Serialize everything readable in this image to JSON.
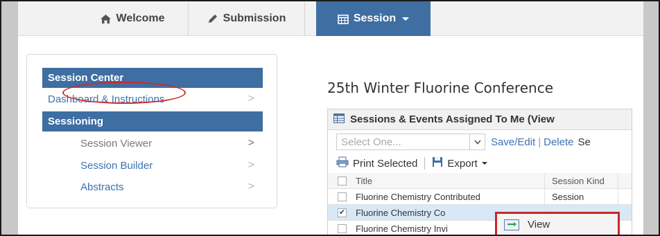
{
  "nav": {
    "tabs": [
      {
        "label": "Welcome",
        "icon": "home-icon"
      },
      {
        "label": "Submission",
        "icon": "pencil-icon"
      },
      {
        "label": "Session",
        "icon": "calendar-icon",
        "active": true
      }
    ]
  },
  "sidebar": {
    "section1": "Session Center",
    "dashboard": "Dashboard & Instructions",
    "section2": "Sessioning",
    "items": [
      {
        "label": "Session Viewer"
      },
      {
        "label": "Session Builder"
      },
      {
        "label": "Abstracts"
      }
    ],
    "arrow": ">"
  },
  "main": {
    "title": "25th Winter Fluorine Conference",
    "panel_title": "Sessions & Events Assigned To Me (View",
    "select_placeholder": "Select One...",
    "save_edit": "Save/Edit",
    "divider": "|",
    "delete": "Delete",
    "cut_text": "Se",
    "print_selected": "Print Selected",
    "export": "Export",
    "columns": [
      "Title",
      "Session Kind"
    ],
    "rows": [
      {
        "title": "Fluorine Chemistry Contributed",
        "kind": "Session",
        "checked": false
      },
      {
        "title": "Fluorine Chemistry Co",
        "kind": "",
        "checked": true
      },
      {
        "title": "Fluorine Chemistry Invi",
        "kind": "",
        "checked": false
      }
    ]
  },
  "context_menu": {
    "view": "View"
  },
  "colors": {
    "accent": "#3f6ea3",
    "link": "#3b73b2",
    "highlight": "#c62828"
  }
}
